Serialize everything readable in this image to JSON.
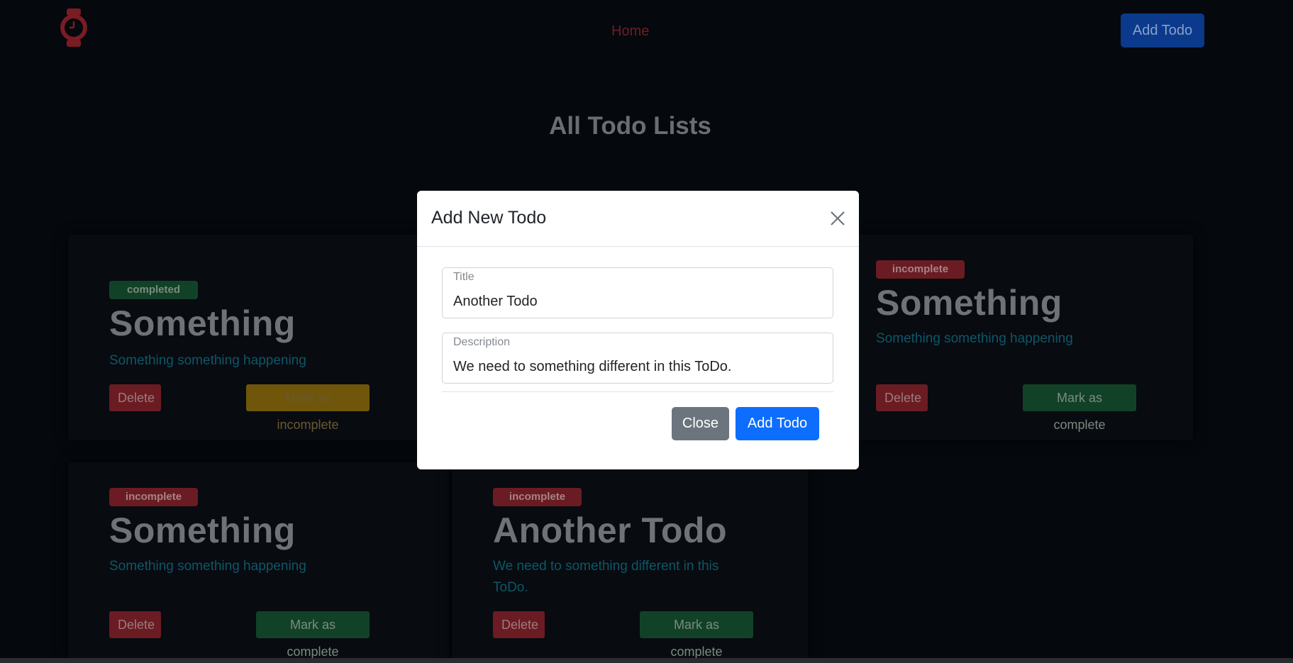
{
  "navbar": {
    "home_label": "Home",
    "add_todo_label": "Add Todo"
  },
  "page": {
    "title": "All Todo Lists"
  },
  "cards": [
    {
      "status": "completed",
      "title": "Something",
      "description": "Something something happening",
      "delete_label": "Delete",
      "toggle_label": "Mark as incomplete"
    },
    {
      "status": "incomplete",
      "title": "Something",
      "description": "Something something happening",
      "delete_label": "Delete",
      "toggle_label": "Mark as complete"
    },
    {
      "status": "incomplete",
      "title": "Something",
      "description": "Something something happening",
      "delete_label": "Delete",
      "toggle_label": "Mark as complete"
    },
    {
      "status": "incomplete",
      "title": "Another Todo",
      "description": "We need to something different in this ToDo.",
      "delete_label": "Delete",
      "toggle_label": "Mark as complete"
    }
  ],
  "modal": {
    "title": "Add New Todo",
    "title_field": {
      "label": "Title",
      "value": "Another Todo"
    },
    "description_field": {
      "label": "Description",
      "value": "We need to something different in this ToDo."
    },
    "close_label": "Close",
    "submit_label": "Add Todo"
  },
  "colors": {
    "background": "#05080d",
    "primary": "#0d6efd",
    "secondary": "#6c757d",
    "danger_dim": "#6a1c22",
    "success_dim": "#114227",
    "warning_dim": "#6f560a"
  }
}
